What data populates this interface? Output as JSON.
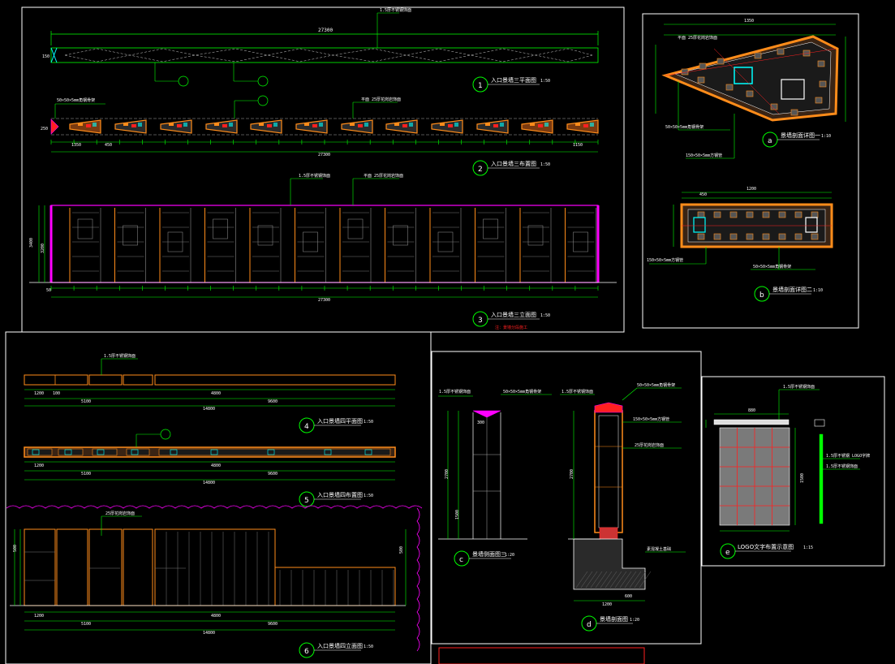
{
  "drawing": {
    "dims": {
      "total_27300": "27300",
      "h_150": "150",
      "h_250": "250",
      "h_3400": "3400",
      "h_3200": "3200",
      "seg_1350": "1350",
      "seg_450": "450",
      "seg_1150": "1150",
      "seg_50": "50",
      "d_1200": "1200",
      "d_100": "100",
      "d_4800": "4800",
      "d_5100": "5100",
      "d_9600": "9600",
      "d_14800": "14800",
      "d_600": "600",
      "d_300": "300",
      "d_2700": "2700",
      "d_1500": "1500",
      "d_500": "500",
      "d_880": "880",
      "d_1350b": "1350"
    },
    "tags": {
      "t1": "1",
      "t2": "2",
      "t3": "3",
      "ta": "a",
      "tb": "b",
      "t4": "4",
      "t5": "5",
      "t6": "6",
      "tc": "c",
      "td": "d",
      "te": "e"
    },
    "titles": {
      "title1": "入口景墙三平面图",
      "title2": "入口景墙三布置图",
      "title3": "入口景墙三立面图",
      "title_a": "景墙剖面详图一",
      "title_b": "景墙剖面详图二",
      "title4": "入口景墙四平面图",
      "title5": "入口景墙四布置图",
      "title6": "入口景墙四立面图",
      "title_c": "景墙侧面图三",
      "title_d": "景墙剖面图",
      "title_e": "LOGO文字布置示意图"
    },
    "scales": {
      "s150": "1:50",
      "s110": "1:10",
      "s115": "1:15",
      "s120": "1:20"
    },
    "notes": {
      "n_steel": "1.5厚不锈钢饰面",
      "n_granite": "平面 25厚花岗岩饰面",
      "n_granite2": "25厚花岗岩饰面",
      "n_frame": "50×50×5mm角钢骨架",
      "n_pipe": "150×50×5mm方钢管",
      "n_logo": "1.5厚不锈钢 LOGO字牌",
      "n_base": "素混凝土基础",
      "n_note_red": "注：景墙分段施工"
    },
    "colors": {
      "frame": "#ffffff",
      "dim_line": "#00ff00",
      "outline": "#ff8c1a",
      "accent_magenta": "#ff00ff",
      "accent_cyan": "#00ffff",
      "accent_red": "#ff2020",
      "panel_fill": "#7a7a7a"
    }
  }
}
